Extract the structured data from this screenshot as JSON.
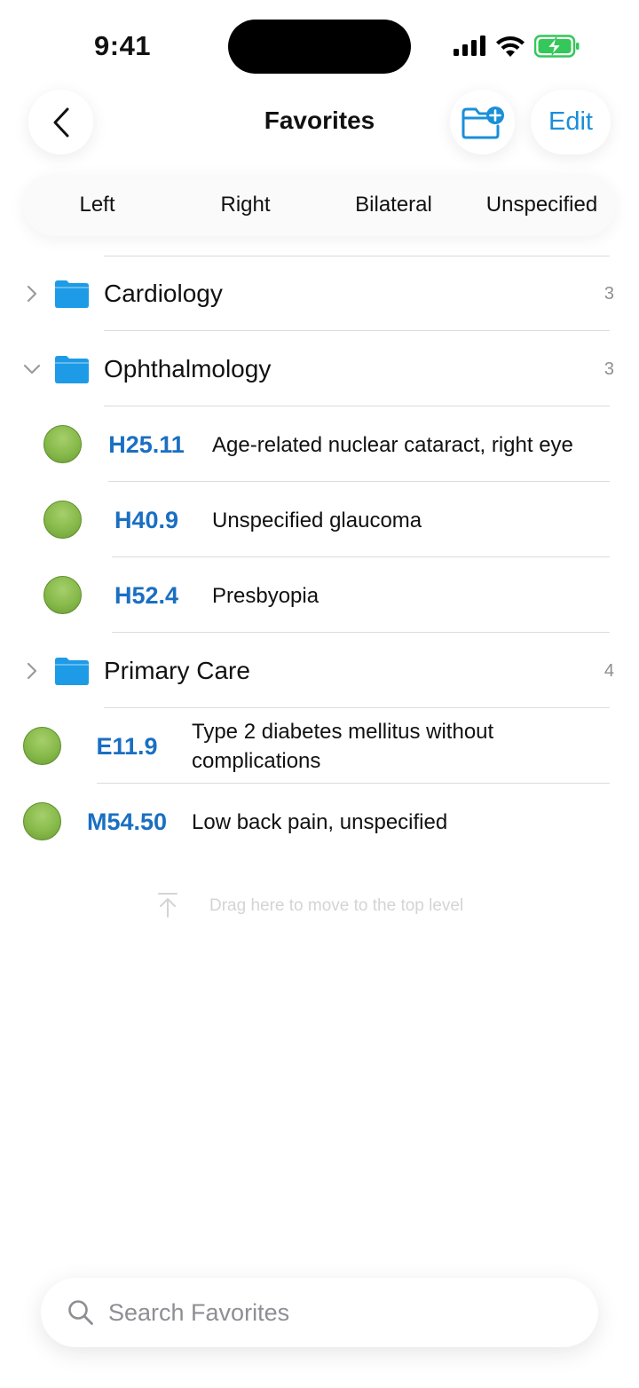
{
  "status_bar": {
    "time": "9:41",
    "battery": "charging"
  },
  "nav": {
    "title": "Favorites",
    "edit_label": "Edit",
    "accent": "#1a8fd8"
  },
  "segments": [
    "Left",
    "Right",
    "Bilateral",
    "Unspecified"
  ],
  "folders": {
    "cardiology": {
      "name": "Cardiology",
      "count": "3",
      "expanded": false
    },
    "ophthalmology": {
      "name": "Ophthalmology",
      "count": "3",
      "expanded": true
    },
    "primary_care": {
      "name": "Primary Care",
      "count": "4",
      "expanded": false
    }
  },
  "ophthalmology_items": [
    {
      "code": "H25.11",
      "description": "Age-related nuclear cataract, right eye"
    },
    {
      "code": "H40.9",
      "description": "Unspecified glaucoma"
    },
    {
      "code": "H52.4",
      "description": "Presbyopia"
    }
  ],
  "top_level_items": [
    {
      "code": "E11.9",
      "description": "Type 2 diabetes mellitus without complications"
    },
    {
      "code": "M54.50",
      "description": "Low back pain, unspecified"
    }
  ],
  "drag_hint": "Drag here to move to the top level",
  "search": {
    "placeholder": "Search Favorites",
    "value": ""
  },
  "colors": {
    "folder": "#1e9be6",
    "code": "#1a6fc2",
    "status_dot": "#86b94a"
  }
}
